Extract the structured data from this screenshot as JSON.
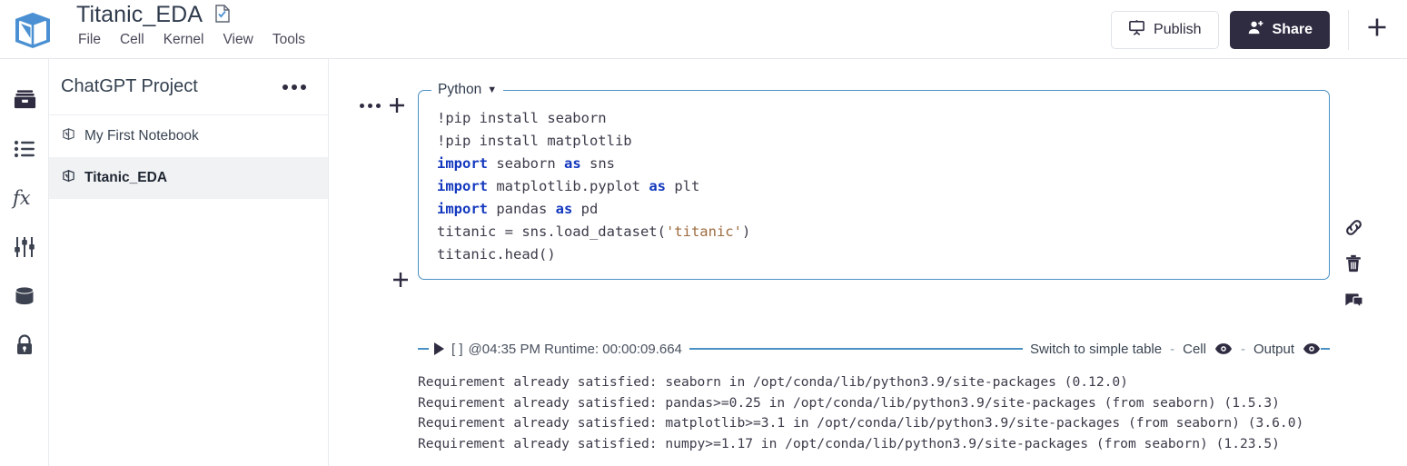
{
  "app": {
    "logo_icon": "notebook-logo-icon",
    "accent_blue": "#4a90c4",
    "dark_navy": "#2f2c42",
    "keyword_blue": "#1338be",
    "string_brown": "#9c6b3e"
  },
  "header": {
    "notebook_title": "Titanic_EDA",
    "saved_icon": "document-check-icon",
    "menu": [
      {
        "label": "File",
        "name": "menu-file"
      },
      {
        "label": "Cell",
        "name": "menu-cell"
      },
      {
        "label": "Kernel",
        "name": "menu-kernel"
      },
      {
        "label": "View",
        "name": "menu-view"
      },
      {
        "label": "Tools",
        "name": "menu-tools"
      }
    ],
    "publish_label": "Publish",
    "publish_icon": "presentation-screen-icon",
    "share_label": "Share",
    "share_icon": "person-plus-icon",
    "add_icon": "plus-icon"
  },
  "rail": [
    {
      "name": "sidebar-icon-files",
      "icon": "file-box-icon",
      "active": true
    },
    {
      "name": "sidebar-icon-outline",
      "icon": "list-settings-icon",
      "active": false
    },
    {
      "name": "sidebar-icon-formula",
      "icon": "fx-icon",
      "active": false
    },
    {
      "name": "sidebar-icon-parameters",
      "icon": "sliders-icon",
      "active": false
    },
    {
      "name": "sidebar-icon-data",
      "icon": "database-icon",
      "active": false
    },
    {
      "name": "sidebar-icon-secrets",
      "icon": "lock-icon",
      "active": false
    }
  ],
  "panel": {
    "project_name": "ChatGPT Project",
    "more_icon": "ellipsis-icon",
    "notebooks": [
      {
        "label": "My First Notebook",
        "selected": false,
        "icon": "notebook-icon"
      },
      {
        "label": "Titanic_EDA",
        "selected": true,
        "icon": "notebook-icon"
      }
    ]
  },
  "cell": {
    "more_icon": "ellipsis-icon",
    "add_above_icon": "plus-icon",
    "add_below_icon": "plus-icon",
    "language_label": "Python",
    "language_caret": "▼",
    "code_lines": [
      {
        "segments": [
          {
            "t": "!pip install seaborn",
            "c": "plain"
          }
        ]
      },
      {
        "segments": [
          {
            "t": "!pip install matplotlib",
            "c": "plain"
          }
        ]
      },
      {
        "segments": [
          {
            "t": "import",
            "c": "kw"
          },
          {
            "t": " seaborn ",
            "c": "plain"
          },
          {
            "t": "as",
            "c": "kw"
          },
          {
            "t": " sns",
            "c": "plain"
          }
        ]
      },
      {
        "segments": [
          {
            "t": "import",
            "c": "kw"
          },
          {
            "t": " matplotlib.pyplot ",
            "c": "plain"
          },
          {
            "t": "as",
            "c": "kw"
          },
          {
            "t": " plt",
            "c": "plain"
          }
        ]
      },
      {
        "segments": [
          {
            "t": "import",
            "c": "kw"
          },
          {
            "t": " pandas ",
            "c": "plain"
          },
          {
            "t": "as",
            "c": "kw"
          },
          {
            "t": " pd",
            "c": "plain"
          }
        ]
      },
      {
        "segments": [
          {
            "t": "titanic = sns.load_dataset(",
            "c": "plain"
          },
          {
            "t": "'titanic'",
            "c": "str"
          },
          {
            "t": ")",
            "c": "plain"
          }
        ]
      },
      {
        "segments": [
          {
            "t": "titanic.head()",
            "c": "plain"
          }
        ]
      }
    ],
    "run_icon": "play-triangle-icon",
    "execution_count": "[ ]",
    "run_meta": "@04:35 PM Runtime: 00:00:09.664",
    "switch_table_label": "Switch to simple table",
    "cell_toggle_label": "Cell",
    "output_toggle_label": "Output",
    "eye_icon": "eye-icon",
    "separator": "-"
  },
  "output": {
    "text": "Requirement already satisfied: seaborn in /opt/conda/lib/python3.9/site-packages (0.12.0)\nRequirement already satisfied: pandas>=0.25 in /opt/conda/lib/python3.9/site-packages (from seaborn) (1.5.3)\nRequirement already satisfied: matplotlib>=3.1 in /opt/conda/lib/python3.9/site-packages (from seaborn) (3.6.0)\nRequirement already satisfied: numpy>=1.17 in /opt/conda/lib/python3.9/site-packages (from seaborn) (1.23.5)"
  },
  "right_tools": [
    {
      "name": "copy-link-button",
      "icon": "link-chain-icon"
    },
    {
      "name": "delete-cell-button",
      "icon": "trash-icon"
    },
    {
      "name": "comment-button",
      "icon": "comment-icon"
    }
  ]
}
